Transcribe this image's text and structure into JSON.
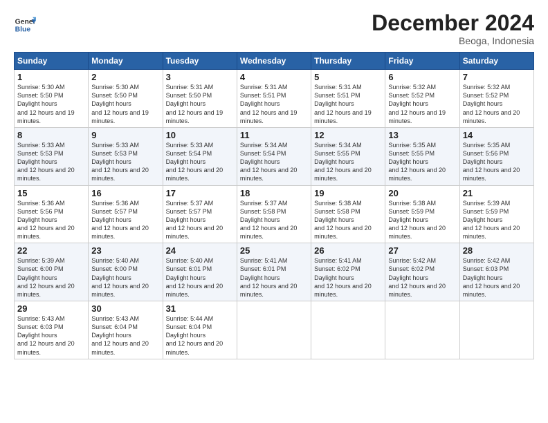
{
  "header": {
    "logo_line1": "General",
    "logo_line2": "Blue",
    "month": "December 2024",
    "location": "Beoga, Indonesia"
  },
  "days_of_week": [
    "Sunday",
    "Monday",
    "Tuesday",
    "Wednesday",
    "Thursday",
    "Friday",
    "Saturday"
  ],
  "weeks": [
    [
      {
        "day": "1",
        "rise": "5:30 AM",
        "set": "5:50 PM",
        "hours": "12 hours and 19 minutes."
      },
      {
        "day": "2",
        "rise": "5:30 AM",
        "set": "5:50 PM",
        "hours": "12 hours and 19 minutes."
      },
      {
        "day": "3",
        "rise": "5:31 AM",
        "set": "5:50 PM",
        "hours": "12 hours and 19 minutes."
      },
      {
        "day": "4",
        "rise": "5:31 AM",
        "set": "5:51 PM",
        "hours": "12 hours and 19 minutes."
      },
      {
        "day": "5",
        "rise": "5:31 AM",
        "set": "5:51 PM",
        "hours": "12 hours and 19 minutes."
      },
      {
        "day": "6",
        "rise": "5:32 AM",
        "set": "5:52 PM",
        "hours": "12 hours and 19 minutes."
      },
      {
        "day": "7",
        "rise": "5:32 AM",
        "set": "5:52 PM",
        "hours": "12 hours and 20 minutes."
      }
    ],
    [
      {
        "day": "8",
        "rise": "5:33 AM",
        "set": "5:53 PM",
        "hours": "12 hours and 20 minutes."
      },
      {
        "day": "9",
        "rise": "5:33 AM",
        "set": "5:53 PM",
        "hours": "12 hours and 20 minutes."
      },
      {
        "day": "10",
        "rise": "5:33 AM",
        "set": "5:54 PM",
        "hours": "12 hours and 20 minutes."
      },
      {
        "day": "11",
        "rise": "5:34 AM",
        "set": "5:54 PM",
        "hours": "12 hours and 20 minutes."
      },
      {
        "day": "12",
        "rise": "5:34 AM",
        "set": "5:55 PM",
        "hours": "12 hours and 20 minutes."
      },
      {
        "day": "13",
        "rise": "5:35 AM",
        "set": "5:55 PM",
        "hours": "12 hours and 20 minutes."
      },
      {
        "day": "14",
        "rise": "5:35 AM",
        "set": "5:56 PM",
        "hours": "12 hours and 20 minutes."
      }
    ],
    [
      {
        "day": "15",
        "rise": "5:36 AM",
        "set": "5:56 PM",
        "hours": "12 hours and 20 minutes."
      },
      {
        "day": "16",
        "rise": "5:36 AM",
        "set": "5:57 PM",
        "hours": "12 hours and 20 minutes."
      },
      {
        "day": "17",
        "rise": "5:37 AM",
        "set": "5:57 PM",
        "hours": "12 hours and 20 minutes."
      },
      {
        "day": "18",
        "rise": "5:37 AM",
        "set": "5:58 PM",
        "hours": "12 hours and 20 minutes."
      },
      {
        "day": "19",
        "rise": "5:38 AM",
        "set": "5:58 PM",
        "hours": "12 hours and 20 minutes."
      },
      {
        "day": "20",
        "rise": "5:38 AM",
        "set": "5:59 PM",
        "hours": "12 hours and 20 minutes."
      },
      {
        "day": "21",
        "rise": "5:39 AM",
        "set": "5:59 PM",
        "hours": "12 hours and 20 minutes."
      }
    ],
    [
      {
        "day": "22",
        "rise": "5:39 AM",
        "set": "6:00 PM",
        "hours": "12 hours and 20 minutes."
      },
      {
        "day": "23",
        "rise": "5:40 AM",
        "set": "6:00 PM",
        "hours": "12 hours and 20 minutes."
      },
      {
        "day": "24",
        "rise": "5:40 AM",
        "set": "6:01 PM",
        "hours": "12 hours and 20 minutes."
      },
      {
        "day": "25",
        "rise": "5:41 AM",
        "set": "6:01 PM",
        "hours": "12 hours and 20 minutes."
      },
      {
        "day": "26",
        "rise": "5:41 AM",
        "set": "6:02 PM",
        "hours": "12 hours and 20 minutes."
      },
      {
        "day": "27",
        "rise": "5:42 AM",
        "set": "6:02 PM",
        "hours": "12 hours and 20 minutes."
      },
      {
        "day": "28",
        "rise": "5:42 AM",
        "set": "6:03 PM",
        "hours": "12 hours and 20 minutes."
      }
    ],
    [
      {
        "day": "29",
        "rise": "5:43 AM",
        "set": "6:03 PM",
        "hours": "12 hours and 20 minutes."
      },
      {
        "day": "30",
        "rise": "5:43 AM",
        "set": "6:04 PM",
        "hours": "12 hours and 20 minutes."
      },
      {
        "day": "31",
        "rise": "5:44 AM",
        "set": "6:04 PM",
        "hours": "12 hours and 20 minutes."
      },
      null,
      null,
      null,
      null
    ]
  ]
}
